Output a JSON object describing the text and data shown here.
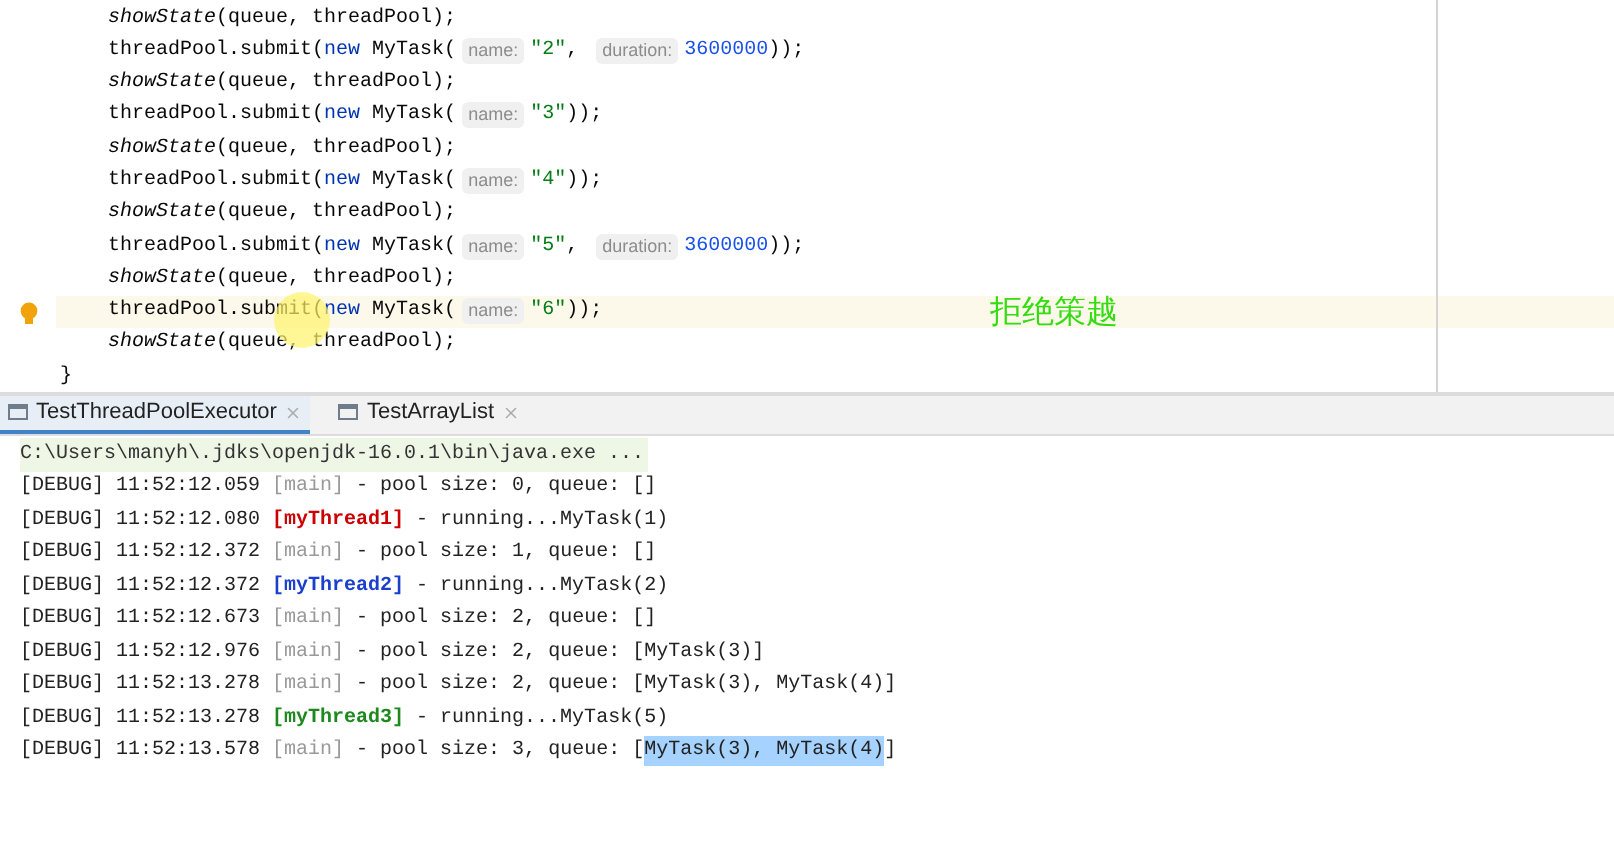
{
  "editor": {
    "lines": [
      {
        "current": false,
        "segments": [
          {
            "kind": "method",
            "text": "showState"
          },
          {
            "kind": "plain",
            "text": "(queue, threadPool);"
          }
        ]
      },
      {
        "current": false,
        "segments": [
          {
            "kind": "plain",
            "text": "threadPool.submit("
          },
          {
            "kind": "keyword",
            "text": "new"
          },
          {
            "kind": "plain",
            "text": " MyTask("
          },
          {
            "kind": "hint",
            "text": "name:"
          },
          {
            "kind": "string",
            "text": "\"2\""
          },
          {
            "kind": "plain",
            "text": ", "
          },
          {
            "kind": "hint",
            "text": "duration:"
          },
          {
            "kind": "number",
            "text": "3600000"
          },
          {
            "kind": "plain",
            "text": "));"
          }
        ]
      },
      {
        "current": false,
        "segments": [
          {
            "kind": "method",
            "text": "showState"
          },
          {
            "kind": "plain",
            "text": "(queue, threadPool);"
          }
        ]
      },
      {
        "current": false,
        "segments": [
          {
            "kind": "plain",
            "text": "threadPool.submit("
          },
          {
            "kind": "keyword",
            "text": "new"
          },
          {
            "kind": "plain",
            "text": " MyTask("
          },
          {
            "kind": "hint",
            "text": "name:"
          },
          {
            "kind": "string",
            "text": "\"3\""
          },
          {
            "kind": "plain",
            "text": "));"
          }
        ]
      },
      {
        "current": false,
        "segments": [
          {
            "kind": "method",
            "text": "showState"
          },
          {
            "kind": "plain",
            "text": "(queue, threadPool);"
          }
        ]
      },
      {
        "current": false,
        "segments": [
          {
            "kind": "plain",
            "text": "threadPool.submit("
          },
          {
            "kind": "keyword",
            "text": "new"
          },
          {
            "kind": "plain",
            "text": " MyTask("
          },
          {
            "kind": "hint",
            "text": "name:"
          },
          {
            "kind": "string",
            "text": "\"4\""
          },
          {
            "kind": "plain",
            "text": "));"
          }
        ]
      },
      {
        "current": false,
        "segments": [
          {
            "kind": "method",
            "text": "showState"
          },
          {
            "kind": "plain",
            "text": "(queue, threadPool);"
          }
        ]
      },
      {
        "current": false,
        "segments": [
          {
            "kind": "plain",
            "text": "threadPool.submit("
          },
          {
            "kind": "keyword",
            "text": "new"
          },
          {
            "kind": "plain",
            "text": " MyTask("
          },
          {
            "kind": "hint",
            "text": "name:"
          },
          {
            "kind": "string",
            "text": "\"5\""
          },
          {
            "kind": "plain",
            "text": ", "
          },
          {
            "kind": "hint",
            "text": "duration:"
          },
          {
            "kind": "number",
            "text": "3600000"
          },
          {
            "kind": "plain",
            "text": "));"
          }
        ]
      },
      {
        "current": false,
        "segments": [
          {
            "kind": "method",
            "text": "showState"
          },
          {
            "kind": "plain",
            "text": "(queue, threadPool);"
          }
        ]
      },
      {
        "current": true,
        "segments": [
          {
            "kind": "plain",
            "text": "threadPool.submit("
          },
          {
            "kind": "keyword",
            "text": "new"
          },
          {
            "kind": "plain",
            "text": " MyTask("
          },
          {
            "kind": "hint",
            "text": "name:"
          },
          {
            "kind": "string",
            "text": "\"6\""
          },
          {
            "kind": "plain",
            "text": "));"
          }
        ]
      },
      {
        "current": false,
        "segments": [
          {
            "kind": "method",
            "text": "showState"
          },
          {
            "kind": "plain",
            "text": "(queue, threadPool);"
          }
        ]
      }
    ],
    "closing_brace": "}",
    "annotation": "拒绝策越"
  },
  "tabs": [
    {
      "label": "TestThreadPoolExecutor",
      "selected": true
    },
    {
      "label": "TestArrayList",
      "selected": false
    }
  ],
  "console": {
    "command": "C:\\Users\\manyh\\.jdks\\openjdk-16.0.1\\bin\\java.exe ...",
    "lines": [
      [
        {
          "kind": "plain",
          "text": "[DEBUG] 11:52:12.059 "
        },
        {
          "kind": "thread",
          "text": "[main]",
          "color": "#999999"
        },
        {
          "kind": "plain",
          "text": " - pool size: 0, queue: []"
        }
      ],
      [
        {
          "kind": "plain",
          "text": "[DEBUG] 11:52:12.080 "
        },
        {
          "kind": "thread",
          "text": "[myThread1]",
          "color": "#cc0000"
        },
        {
          "kind": "plain",
          "text": " - running...MyTask(1)"
        }
      ],
      [
        {
          "kind": "plain",
          "text": "[DEBUG] 11:52:12.372 "
        },
        {
          "kind": "thread",
          "text": "[main]",
          "color": "#999999"
        },
        {
          "kind": "plain",
          "text": " - pool size: 1, queue: []"
        }
      ],
      [
        {
          "kind": "plain",
          "text": "[DEBUG] 11:52:12.372 "
        },
        {
          "kind": "thread",
          "text": "[myThread2]",
          "color": "#1a3fcc"
        },
        {
          "kind": "plain",
          "text": " - running...MyTask(2)"
        }
      ],
      [
        {
          "kind": "plain",
          "text": "[DEBUG] 11:52:12.673 "
        },
        {
          "kind": "thread",
          "text": "[main]",
          "color": "#999999"
        },
        {
          "kind": "plain",
          "text": " - pool size: 2, queue: []"
        }
      ],
      [
        {
          "kind": "plain",
          "text": "[DEBUG] 11:52:12.976 "
        },
        {
          "kind": "thread",
          "text": "[main]",
          "color": "#999999"
        },
        {
          "kind": "plain",
          "text": " - pool size: 2, queue: [MyTask(3)]"
        }
      ],
      [
        {
          "kind": "plain",
          "text": "[DEBUG] 11:52:13.278 "
        },
        {
          "kind": "thread",
          "text": "[main]",
          "color": "#999999"
        },
        {
          "kind": "plain",
          "text": " - pool size: 2, queue: [MyTask(3), MyTask(4)]"
        }
      ],
      [
        {
          "kind": "plain",
          "text": "[DEBUG] 11:52:13.278 "
        },
        {
          "kind": "thread",
          "text": "[myThread3]",
          "color": "#1e8a1e"
        },
        {
          "kind": "plain",
          "text": " - running...MyTask(5)"
        }
      ],
      [
        {
          "kind": "plain",
          "text": "[DEBUG] 11:52:13.578 "
        },
        {
          "kind": "thread",
          "text": "[main]",
          "color": "#999999"
        },
        {
          "kind": "plain",
          "text": " - pool size: 3, queue: ["
        },
        {
          "kind": "selected",
          "text": "MyTask(3), MyTask(4)"
        },
        {
          "kind": "plain",
          "text": "]"
        }
      ]
    ]
  }
}
